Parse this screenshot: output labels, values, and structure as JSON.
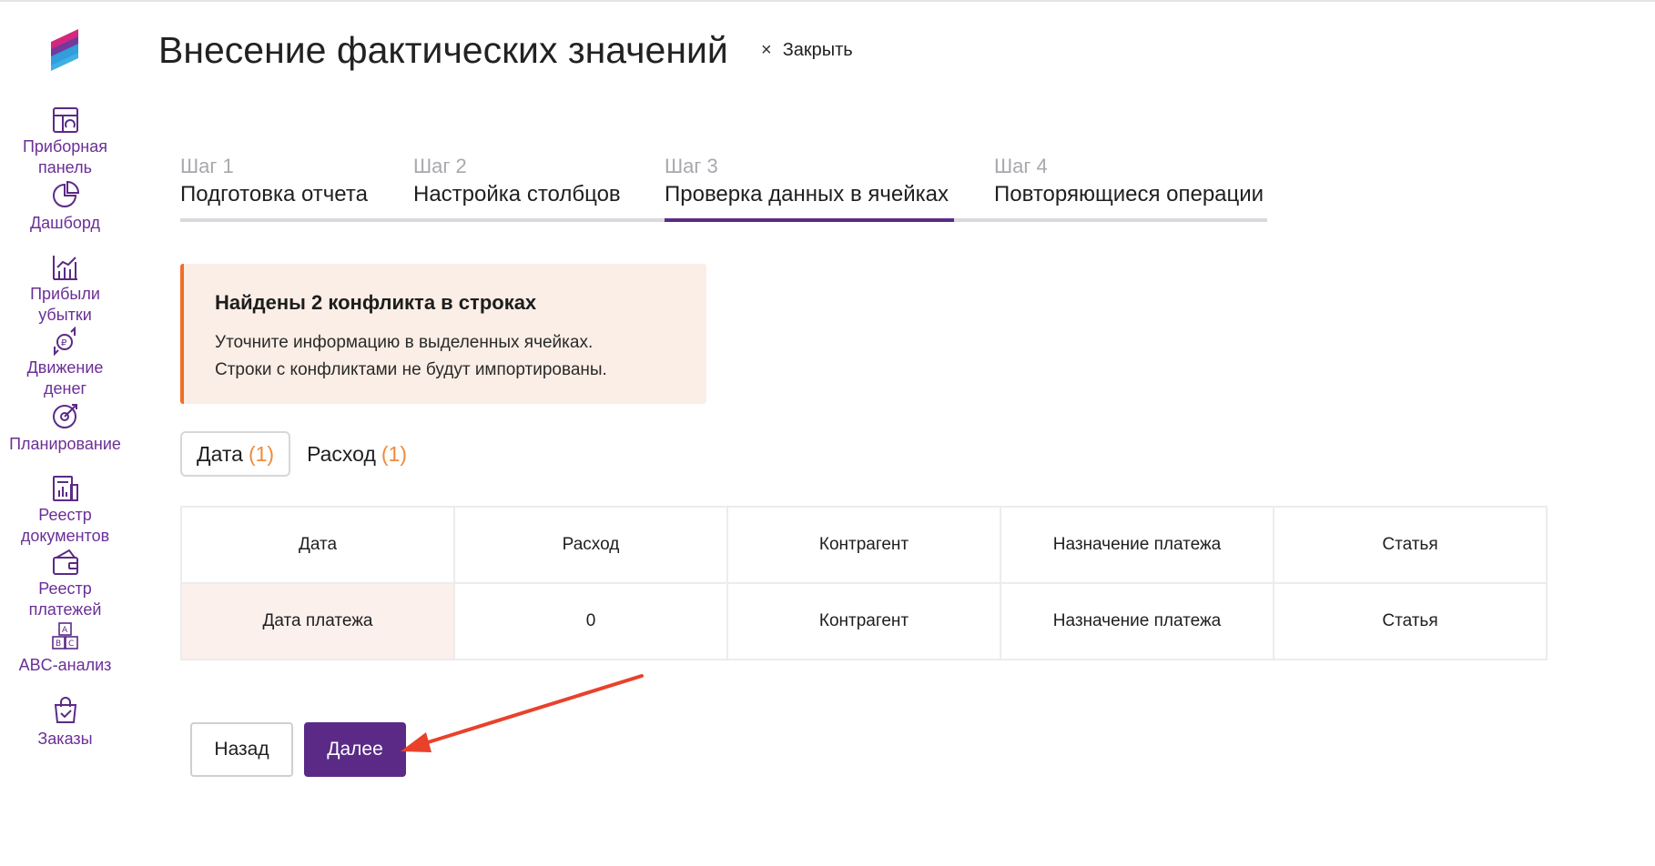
{
  "page": {
    "title": "Внесение фактических значений",
    "close_label": "Закрыть"
  },
  "sidebar": {
    "items": [
      {
        "label": "Приборная\nпанель",
        "icon": "dashboard-panel-icon"
      },
      {
        "label": "Дашборд",
        "icon": "pie-chart-icon"
      },
      {
        "label": "Прибыли\nубытки",
        "icon": "bar-chart-icon"
      },
      {
        "label": "Движение\nденег",
        "icon": "money-flow-icon"
      },
      {
        "label": "Планирование",
        "icon": "target-icon"
      },
      {
        "label": "Реестр\nдокументов",
        "icon": "documents-icon"
      },
      {
        "label": "Реестр\nплатежей",
        "icon": "wallet-icon"
      },
      {
        "label": "ABC-анализ",
        "icon": "abc-blocks-icon"
      },
      {
        "label": "Заказы",
        "icon": "shopping-bag-icon"
      }
    ]
  },
  "steps": [
    {
      "num": "Шаг 1",
      "name": "Подготовка отчета",
      "active": false
    },
    {
      "num": "Шаг 2",
      "name": "Настройка столбцов",
      "active": false
    },
    {
      "num": "Шаг 3",
      "name": "Проверка данных в ячейках",
      "active": true
    },
    {
      "num": "Шаг 4",
      "name": "Повторяющиеся операции",
      "active": false
    }
  ],
  "alert": {
    "heading": "Найдены 2 конфликта в строках",
    "line1": "Уточните информацию в выделенных ячейках.",
    "line2": "Строки с конфликтами не будут импортированы."
  },
  "filters": [
    {
      "label": "Дата",
      "count": "(1)",
      "selected": true
    },
    {
      "label": "Расход",
      "count": "(1)",
      "selected": false
    }
  ],
  "table": {
    "headers": [
      "Дата",
      "Расход",
      "Контрагент",
      "Назначение платежа",
      "Статья"
    ],
    "rows": [
      [
        "Дата платежа",
        "0",
        "Контрагент",
        "Назначение платежа",
        "Статья"
      ]
    ]
  },
  "buttons": {
    "back": "Назад",
    "next": "Далее"
  },
  "colors": {
    "accent": "#5b2a86",
    "warning": "#f26d2a",
    "count": "#f08a3c",
    "nav_text": "#6b2f97"
  }
}
